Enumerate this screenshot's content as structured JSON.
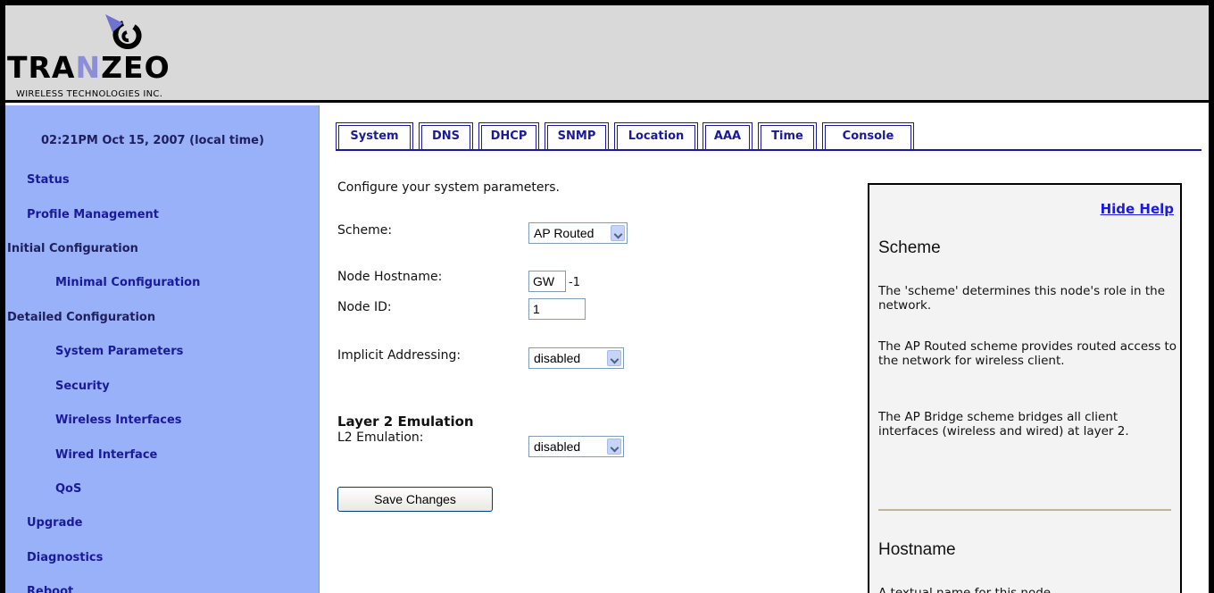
{
  "header": {
    "logo_text_pre": "TRA",
    "logo_text_n": "N",
    "logo_text_post": "ZEO",
    "logo_sub": "WIRELESS TECHNOLOGIES INC."
  },
  "sidebar": {
    "clock": "02:21PM Oct 15, 2007 (local time)",
    "items": [
      {
        "label": "Status"
      },
      {
        "label": "Profile Management"
      },
      {
        "label": "Initial Configuration"
      },
      {
        "label": "Minimal Configuration"
      },
      {
        "label": "Detailed Configuration"
      },
      {
        "label": "System Parameters"
      },
      {
        "label": "Security"
      },
      {
        "label": "Wireless Interfaces"
      },
      {
        "label": "Wired Interface"
      },
      {
        "label": "QoS"
      },
      {
        "label": "Upgrade"
      },
      {
        "label": "Diagnostics"
      },
      {
        "label": "Reboot"
      }
    ]
  },
  "tabs": [
    "System",
    "DNS",
    "DHCP",
    "SNMP",
    "Location",
    "AAA",
    "Time",
    "Console"
  ],
  "form": {
    "intro": "Configure your system parameters.",
    "scheme_label": "Scheme:",
    "scheme_value": "AP Routed",
    "hostname_label": "Node Hostname:",
    "hostname_value": "GW",
    "hostname_suffix": "-1",
    "nodeid_label": "Node ID:",
    "nodeid_value": "1",
    "implicit_label": "Implicit Addressing:",
    "implicit_value": "disabled",
    "l2_heading": "Layer 2 Emulation",
    "l2_label": "L2 Emulation:",
    "l2_value": "disabled",
    "save_label": "Save Changes"
  },
  "help": {
    "hide_link": "Hide Help",
    "scheme_title": "Scheme",
    "scheme_p1": "The 'scheme' determines this node's role in the network.",
    "scheme_p2": "The AP Routed scheme provides routed access to the network for wireless client.",
    "scheme_p3": "The AP Bridge scheme bridges all client interfaces (wireless and wired) at layer 2.",
    "hostname_title": "Hostname",
    "hostname_p1": "A textual name for this node."
  },
  "colors": {
    "sidebar_bg": "#99b1f9",
    "nav_text": "#1a1a9a",
    "header_bg": "#d9d9d9",
    "help_bg": "#f3f3f3"
  }
}
